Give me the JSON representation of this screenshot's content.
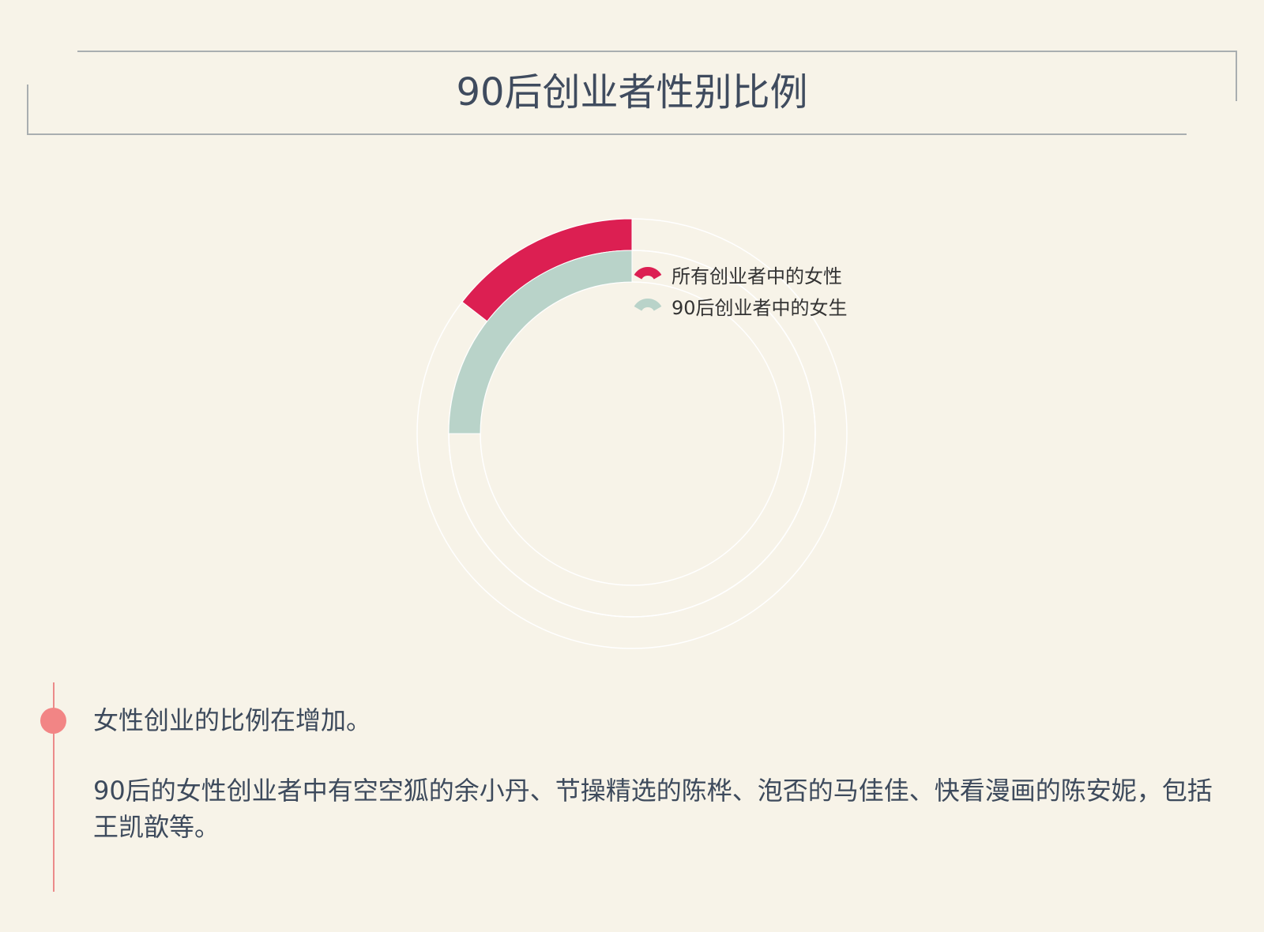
{
  "title": "90后创业者性别比例",
  "chart_data": {
    "type": "pie",
    "subtype": "concentric-ring-progress",
    "max_value": 100,
    "series": [
      {
        "name": "所有创业者中的女性",
        "value": 14.5,
        "color": "#dc1f52",
        "ring": "outer"
      },
      {
        "name": "90后创业者中的女生",
        "value": 25,
        "color": "#b9d3c9",
        "ring": "inner"
      }
    ],
    "track_color": "#ffffff",
    "legend_position": "top-right"
  },
  "notes": [
    "女性创业的比例在增加。",
    "90后的女性创业者中有空空狐的余小丹、节操精选的陈桦、泡否的马佳佳、快看漫画的陈安妮，包括王凯歆等。"
  ],
  "colors": {
    "background": "#f7f3e8",
    "frame": "#a9aeb0",
    "timeline": "#f28585",
    "text": "#3d4a5c"
  }
}
